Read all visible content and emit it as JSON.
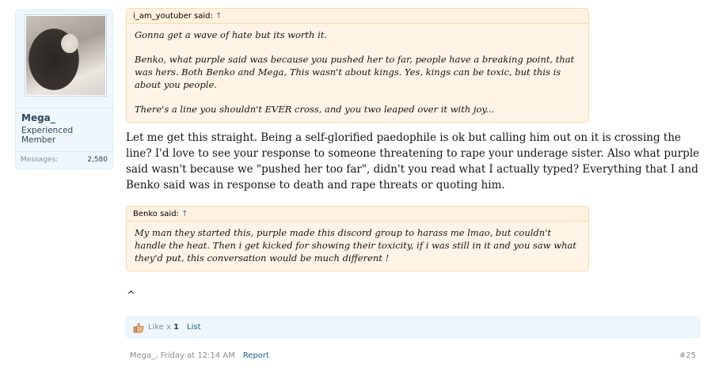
{
  "user": {
    "name": "Mega_",
    "title": "Experienced Member",
    "messages_label": "Messages:",
    "messages_count": "2,580"
  },
  "quotes": [
    {
      "author": "i_am_youtuber said:",
      "arrow": "↑",
      "paragraphs": [
        "Gonna get a wave of hate but its worth it.",
        "Benko, what purple said was because you pushed her to far, people have a breaking point, that was hers. Both Benko and Mega, This wasn't about kings. Yes, kings can be toxic, but this is about you people.",
        "There's a line you shouldn't EVER cross, and you two leaped over it with joy..."
      ]
    },
    {
      "author": "Benko said:",
      "arrow": "↑",
      "paragraphs": [
        "My man they started this, purple made this discord group to harass me lmao, but couldn't handle the heat. Then i get kicked for showing their toxicity, if i was still in it and you saw what they'd put, this conversation would be much different !"
      ]
    }
  ],
  "message": {
    "text": "Let me get this straight. Being a self-glorified paedophile is ok but calling him out on it is crossing the line? I'd love to see your response to someone threatening to rape your underage sister. Also what purple said wasn't because we \"pushed her too far\", didn't you read what I actually typed? Everything that I and Benko said was in response to death and rape threats or quoting him.",
    "caret": "^"
  },
  "likes": {
    "label": "Like x",
    "count": "1",
    "list": "List",
    "icon": "thumbs-up-icon"
  },
  "footer": {
    "author_time": "Mega_, Friday at 12:14 AM",
    "report": "Report",
    "post_number": "#25"
  }
}
